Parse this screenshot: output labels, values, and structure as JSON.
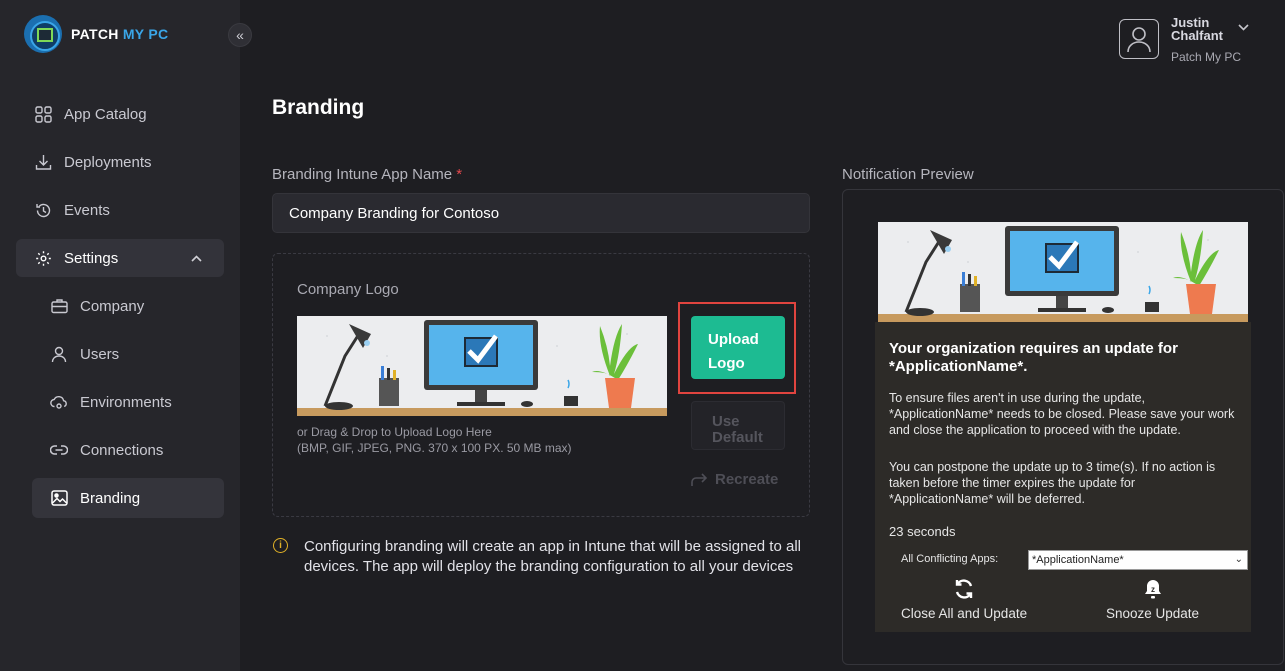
{
  "brand": {
    "name_part1": "PATCH ",
    "name_part2": "MY PC"
  },
  "sidebar": {
    "collapse_glyph": "«",
    "items": [
      {
        "label": "App Catalog",
        "icon": "grid-icon"
      },
      {
        "label": "Deployments",
        "icon": "download-icon"
      },
      {
        "label": "Events",
        "icon": "history-icon"
      },
      {
        "label": "Settings",
        "icon": "gear-icon",
        "expanded": true
      }
    ],
    "settings_children": [
      {
        "label": "Company",
        "icon": "briefcase-icon"
      },
      {
        "label": "Users",
        "icon": "user-icon"
      },
      {
        "label": "Environments",
        "icon": "cloud-icon"
      },
      {
        "label": "Connections",
        "icon": "link-icon"
      },
      {
        "label": "Branding",
        "icon": "image-icon",
        "active": true
      }
    ]
  },
  "user": {
    "name": "Justin Chalfant",
    "org": "Patch My PC"
  },
  "page": {
    "title": "Branding"
  },
  "form": {
    "app_name_label": "Branding Intune App Name",
    "required_mark": "*",
    "app_name_value": "Company Branding for Contoso",
    "company_logo_label": "Company Logo",
    "drag_hint_line1": "or Drag & Drop to Upload Logo Here",
    "drag_hint_line2": "(BMP, GIF, JPEG, PNG. 370 x 100 PX. 50 MB max)",
    "upload_line1": "Upload",
    "upload_line2": "Logo",
    "default_line1": "Use",
    "default_line2": "Default",
    "recreate_label": "Recreate",
    "info_text": "Configuring branding will create an app in Intune that will be assigned to all devices. The app will deploy the branding configuration to all your devices"
  },
  "notification": {
    "label": "Notification Preview",
    "heading": "Your organization requires an update for *ApplicationName*.",
    "body1": "To ensure files aren't in use during the update, *ApplicationName* needs to be closed. Please save your work and close the application to proceed with the update.",
    "body2": "You can postpone the update up to 3 time(s). If no action is taken before the timer expires the update for *ApplicationName* will be deferred.",
    "countdown": "23 seconds",
    "conflicting_label": "All Conflicting Apps:",
    "conflicting_value": "*ApplicationName*",
    "close_all_label": "Close All and Update",
    "snooze_label": "Snooze Update"
  },
  "colors": {
    "accent_teal": "#1dbb92",
    "highlight_red": "#e0443f",
    "required_red": "#e5484d",
    "warning_yellow": "#e0b127",
    "brand_blue": "#3aa6e8"
  }
}
